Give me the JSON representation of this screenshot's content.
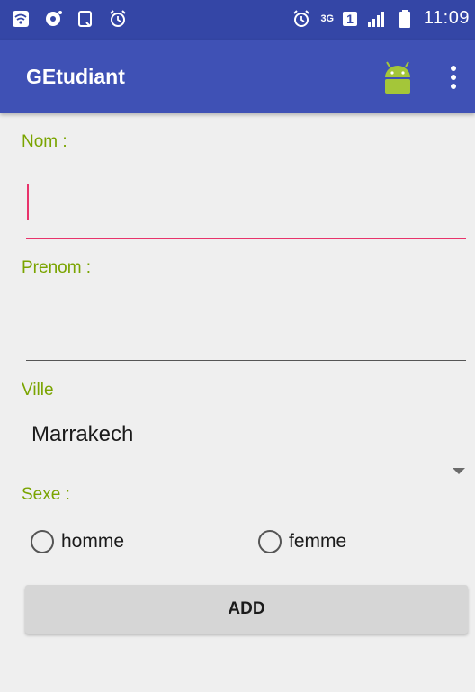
{
  "status_bar": {
    "time": "11:09",
    "network": "3G",
    "sim": "1",
    "left_icons": [
      "wifi-icon",
      "notification-icon",
      "tablet-icon",
      "alarm-icon"
    ],
    "right_icons": [
      "alarm-icon",
      "network-3g-icon",
      "sim-icon",
      "signal-icon",
      "battery-icon"
    ]
  },
  "app_bar": {
    "title": "GEtudiant",
    "color": "#3f51b5",
    "icons": [
      "android-icon",
      "overflow-menu-icon"
    ]
  },
  "form": {
    "nom_label": "Nom :",
    "nom_value": "",
    "prenom_label": "Prenom :",
    "prenom_value": "",
    "ville_label": "Ville",
    "ville_selected": "Marrakech",
    "sexe_label": "Sexe :",
    "radio_options": [
      "homme",
      "femme"
    ],
    "add_button_label": "ADD"
  },
  "colors": {
    "accent": "#e8336b",
    "label": "#7aa400",
    "primary": "#3f51b5",
    "primary_dark": "#3446a6"
  }
}
